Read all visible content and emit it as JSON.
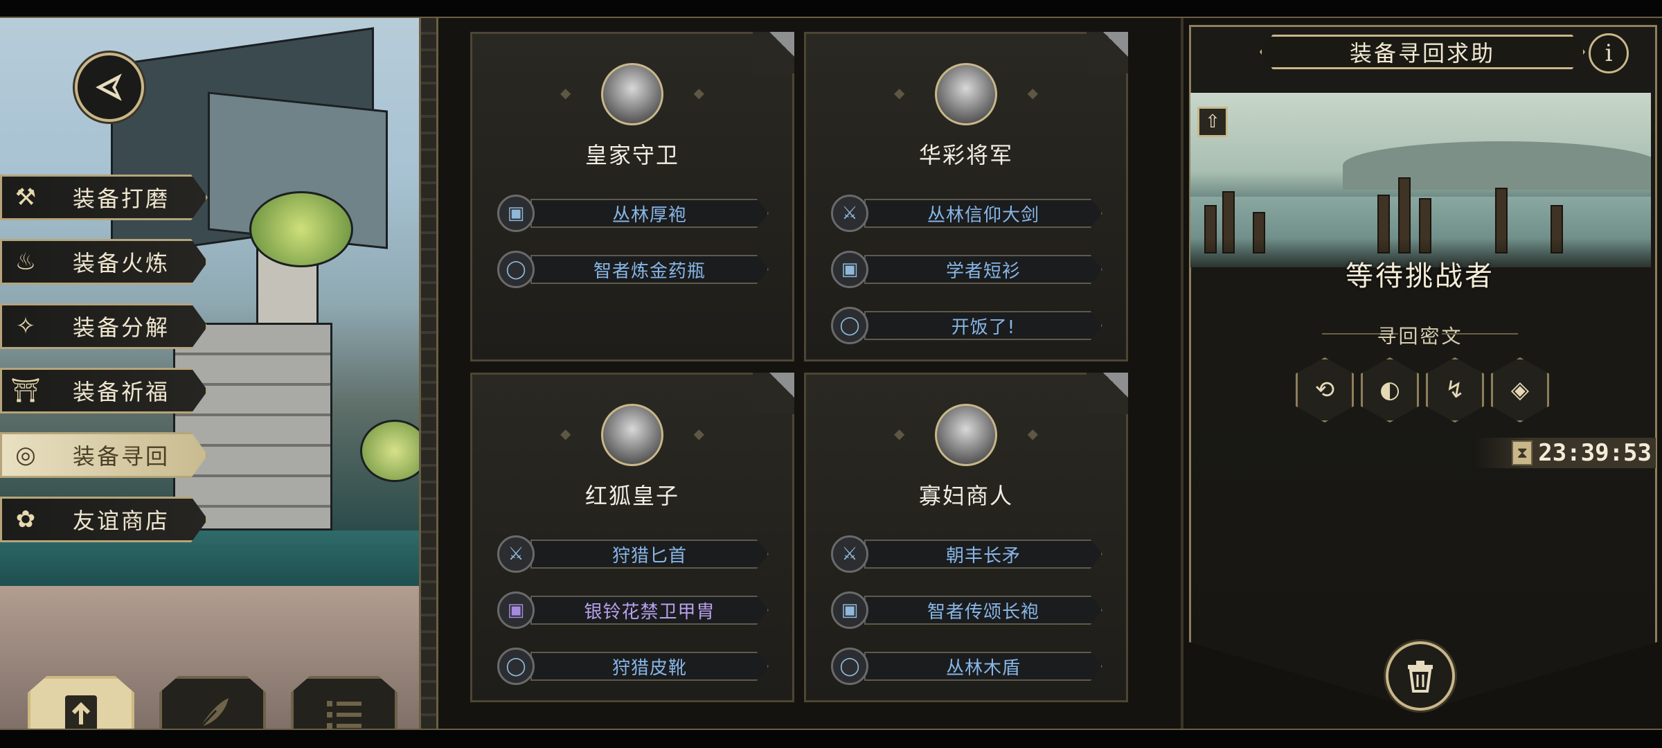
{
  "sidebar": {
    "back_icon": "back-arrow-icon",
    "items": [
      {
        "label": "装备打磨",
        "icon": "hammer-icon",
        "glyph": "⚒",
        "active": false
      },
      {
        "label": "装备火炼",
        "icon": "flame-icon",
        "glyph": "♨",
        "active": false
      },
      {
        "label": "装备分解",
        "icon": "decompose-icon",
        "glyph": "✧",
        "active": false
      },
      {
        "label": "装备祈福",
        "icon": "pray-icon",
        "glyph": "⛩",
        "active": false
      },
      {
        "label": "装备寻回",
        "icon": "retrieve-icon",
        "glyph": "◎",
        "active": true
      },
      {
        "label": "友谊商店",
        "icon": "fox-icon",
        "glyph": "✿",
        "active": false
      }
    ],
    "bottom_tabs": [
      {
        "icon": "upload-icon",
        "active": true
      },
      {
        "icon": "feather-icon",
        "active": false
      },
      {
        "icon": "list-icon",
        "active": false
      }
    ]
  },
  "cards": [
    {
      "name": "皇家守卫",
      "portrait": "royal-guard-portrait",
      "slots": [
        {
          "label": "丛林厚袍",
          "icon": "armor-icon",
          "glyph": "▣",
          "color": "blue"
        },
        {
          "label": "智者炼金药瓶",
          "icon": "ring-icon",
          "glyph": "◯",
          "color": "blue"
        }
      ]
    },
    {
      "name": "华彩将军",
      "portrait": "general-portrait",
      "slots": [
        {
          "label": "丛林信仰大剑",
          "icon": "sword-icon",
          "glyph": "⚔",
          "color": "blue"
        },
        {
          "label": "学者短衫",
          "icon": "armor-icon",
          "glyph": "▣",
          "color": "blue"
        },
        {
          "label": "开饭了!",
          "icon": "ring-icon",
          "glyph": "◯",
          "color": "blue"
        }
      ]
    },
    {
      "name": "红狐皇子",
      "portrait": "fox-prince-portrait",
      "slots": [
        {
          "label": "狩猎匕首",
          "icon": "sword-icon",
          "glyph": "⚔",
          "color": "blue"
        },
        {
          "label": "银铃花禁卫甲胄",
          "icon": "armor-icon",
          "glyph": "▣",
          "color": "purple"
        },
        {
          "label": "狩猎皮靴",
          "icon": "ring-icon",
          "glyph": "◯",
          "color": "blue"
        }
      ]
    },
    {
      "name": "寡妇商人",
      "portrait": "widow-merchant-portrait",
      "slots": [
        {
          "label": "朝丰长矛",
          "icon": "sword-icon",
          "glyph": "⚔",
          "color": "blue"
        },
        {
          "label": "智者传颂长袍",
          "icon": "armor-icon",
          "glyph": "▣",
          "color": "blue"
        },
        {
          "label": "丛林木盾",
          "icon": "ring-icon",
          "glyph": "◯",
          "color": "blue"
        }
      ]
    }
  ],
  "panel": {
    "title": "装备寻回求助",
    "info_glyph": "i",
    "status": "等待挑战者",
    "cipher_label": "寻回密文",
    "ciphers": [
      {
        "icon": "cipher-rune-1-icon",
        "glyph": "⟲"
      },
      {
        "icon": "cipher-rune-2-icon",
        "glyph": "◐"
      },
      {
        "icon": "cipher-rune-3-icon",
        "glyph": "↯"
      },
      {
        "icon": "cipher-rune-4-icon",
        "glyph": "◈"
      }
    ],
    "timer": "23:39:53",
    "timer_icon": "hourglass-icon",
    "trash_icon": "trash-icon"
  },
  "colors": {
    "gold": "#c9b78a",
    "item_blue": "#87b6e6",
    "item_purple": "#b8a0ec"
  }
}
